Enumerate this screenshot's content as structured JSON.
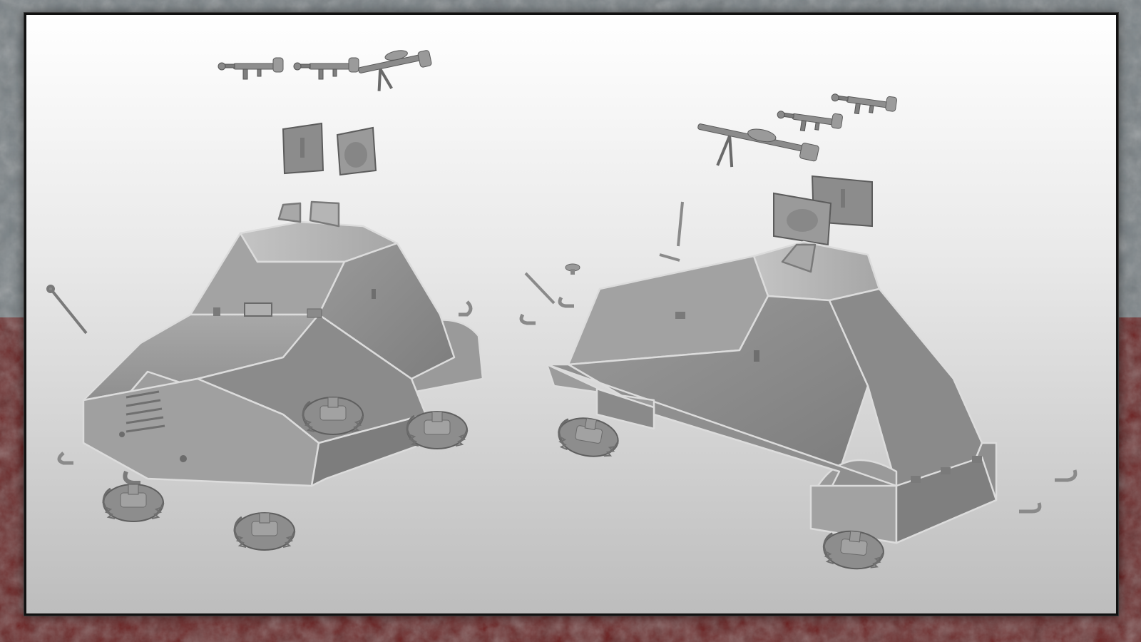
{
  "image": {
    "subject": "exploded-3d-model-renders",
    "models": [
      {
        "name": "armored-car-front-three-quarter-view",
        "parts": [
          "hull",
          "weapons",
          "armor-plates",
          "wheels",
          "headlight-rods",
          "tow-hooks"
        ]
      },
      {
        "name": "armored-car-rear-three-quarter-view",
        "parts": [
          "hull",
          "weapons",
          "armor-plates",
          "wheels",
          "rods",
          "hooks"
        ]
      }
    ]
  },
  "colors": {
    "border_red": "#7a1414",
    "border_red_dark": "#4a0808",
    "border_grey": "#8a9296",
    "border_grey_dark": "#4f575c",
    "panel_top": "#ffffff",
    "panel_bottom": "#bdbdbd",
    "model_light": "#b9b9b9",
    "model_mid": "#9c9c9c",
    "model_dark": "#7c7c7c",
    "weld_seam": "#d9d9d9",
    "wheel": "#909090"
  }
}
